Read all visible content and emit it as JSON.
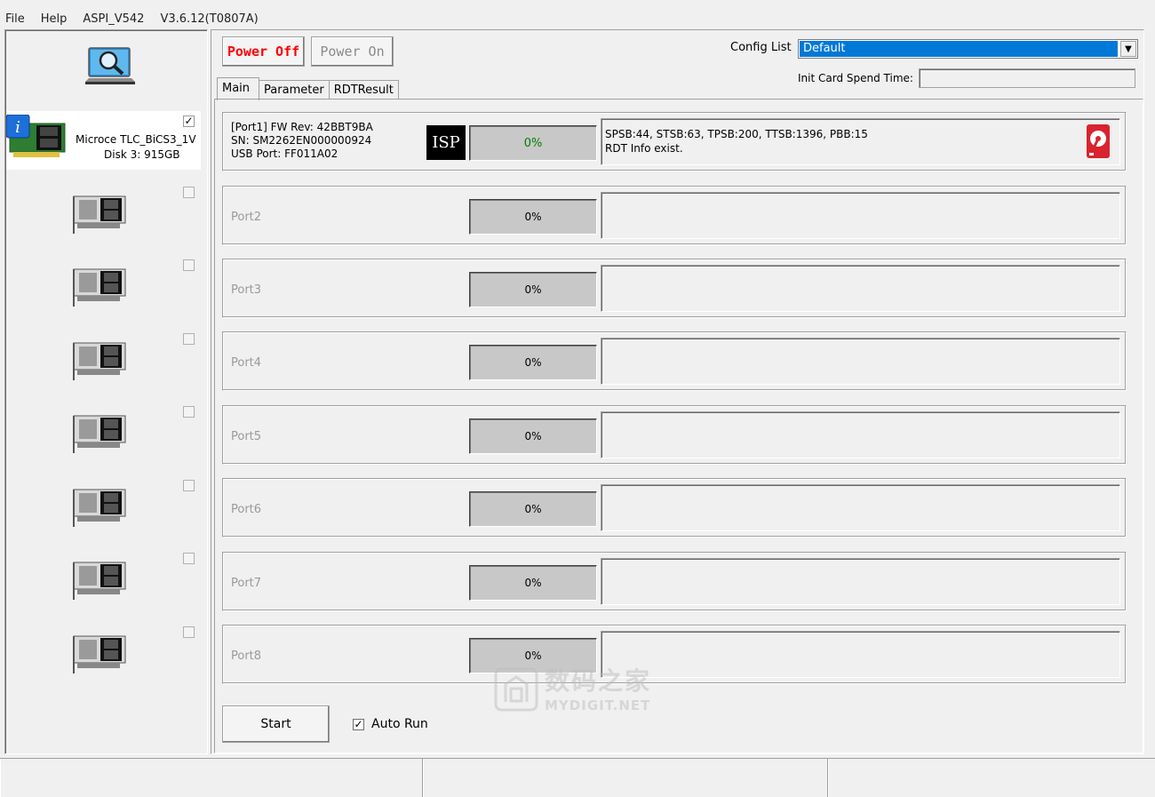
{
  "menubar": {
    "file": "File",
    "help": "Help",
    "app": "ASPI_V542",
    "version": "V3.6.12(T0807A)"
  },
  "toolbar": {
    "power_off": "Power Off",
    "power_on": "Power On",
    "config_label": "Config List",
    "config_value": "Default",
    "init_label": "Init Card Spend Time:",
    "init_value": ""
  },
  "tabs": [
    "Main",
    "Parameter",
    "RDTResult"
  ],
  "devices": [
    {
      "name": "Microce TLC_BiCS3_1V",
      "disk": "Disk 3:  915GB",
      "checked": true
    },
    {
      "checked": false
    },
    {
      "checked": false
    },
    {
      "checked": false
    },
    {
      "checked": false
    },
    {
      "checked": false
    },
    {
      "checked": false
    },
    {
      "checked": false
    }
  ],
  "ports": [
    {
      "label": "Port1",
      "info": [
        "[Port1] FW Rev: 42BBT9BA",
        "SN: SM2262EN000000924",
        "USB Port: FF011A02"
      ],
      "isp": "ISP",
      "progress": "0%",
      "progress_value": 0,
      "status": [
        "SPSB:44, STSB:63, TPSB:200, TTSB:1396, PBB:15",
        "RDT Info exist."
      ]
    },
    {
      "label": "Port2",
      "progress": "0%",
      "progress_value": 0
    },
    {
      "label": "Port3",
      "progress": "0%",
      "progress_value": 0
    },
    {
      "label": "Port4",
      "progress": "0%",
      "progress_value": 0
    },
    {
      "label": "Port5",
      "progress": "0%",
      "progress_value": 0
    },
    {
      "label": "Port6",
      "progress": "0%",
      "progress_value": 0
    },
    {
      "label": "Port7",
      "progress": "0%",
      "progress_value": 0
    },
    {
      "label": "Port8",
      "progress": "0%",
      "progress_value": 0
    }
  ],
  "footer": {
    "start": "Start",
    "auto_run": "Auto Run",
    "auto_run_checked": true
  },
  "watermark": {
    "line1": "数码之家",
    "line2": "MYDIGIT.NET"
  },
  "colors": {
    "power_off": "#ff0000",
    "selection": "#0078d7",
    "progress_fill": "#c8c8c8",
    "disk_icon": "#d9232e"
  },
  "check_glyph": "✓"
}
